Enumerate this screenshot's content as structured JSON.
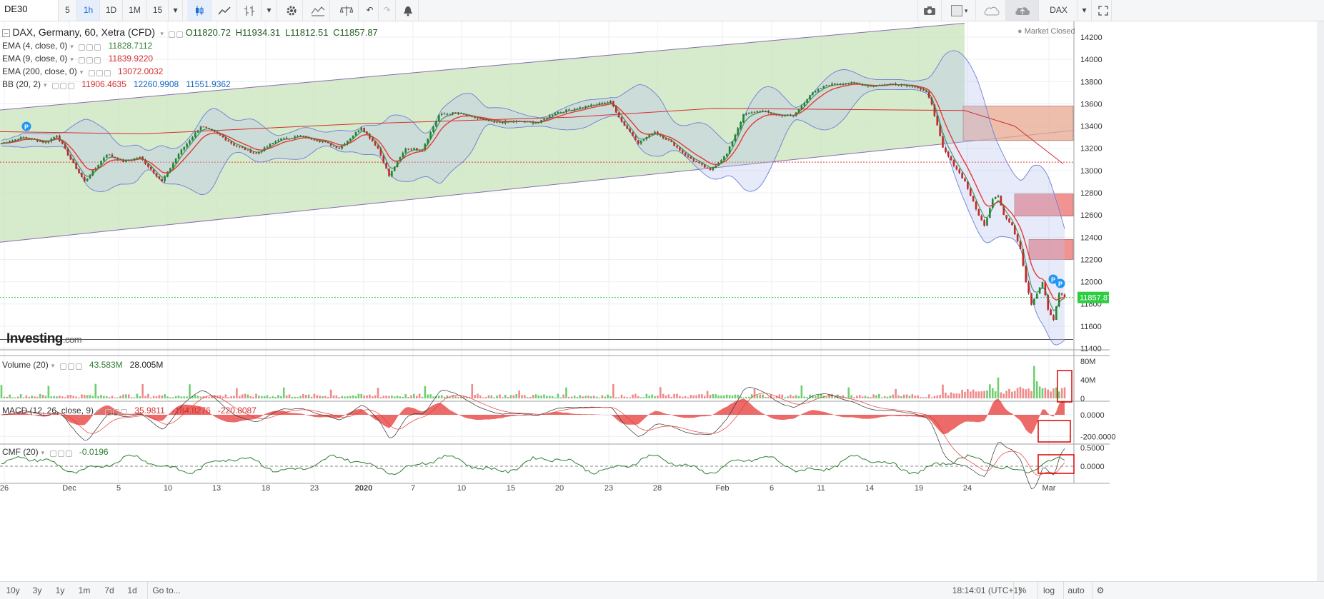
{
  "toolbar": {
    "symbol": "DE30",
    "intervals": [
      "5",
      "1h",
      "1D",
      "1M",
      "15"
    ],
    "active_interval": "1h",
    "right_symbol": "DAX"
  },
  "legend": {
    "main": {
      "title": "DAX, Germany, 60, Xetra (CFD)",
      "open": "O11820.72",
      "high": "H11934.31",
      "low": "L11812.51",
      "close": "C11857.87"
    },
    "ema4": {
      "label": "EMA (4, close, 0)",
      "value": "11828.7112"
    },
    "ema9": {
      "label": "EMA (9, close, 0)",
      "value": "11839.9220"
    },
    "ema200": {
      "label": "EMA (200, close, 0)",
      "value": "13072.0032"
    },
    "bb": {
      "label": "BB (20, 2)",
      "v1": "11906.4635",
      "v2": "12260.9908",
      "v3": "11551.9362"
    },
    "market_status": "Market Closed",
    "logo_main": "Investing",
    "logo_suffix": ".com",
    "last_price": "11857.87"
  },
  "volume_legend": {
    "label": "Volume (20)",
    "v1": "43.583M",
    "v2": "28.005M"
  },
  "macd_legend": {
    "label": "MACD (12, 26, close, 9)",
    "v1": "35.9811",
    "v2": "-184.8276",
    "v3": "-220.8087"
  },
  "cmf_legend": {
    "label": "CMF (20)",
    "v1": "-0.0196"
  },
  "bottom": {
    "ranges": [
      "10y",
      "3y",
      "1y",
      "1m",
      "7d",
      "1d"
    ],
    "goto": "Go to...",
    "time": "18:14:01 (UTC+1)",
    "pct": "%",
    "log": "log",
    "auto": "auto"
  },
  "colors": {
    "up": "#26a69a",
    "down": "#ef5350",
    "channel": "#cfe6c3",
    "bb": "#6b7fd7",
    "ema200": "#d32f2f",
    "zone_orange": "#e5a88f",
    "zone_red": "#f08080"
  },
  "chart_data": [
    {
      "type": "candlestick",
      "title": "DAX, Germany, 60, Xetra (CFD)",
      "x_labels": [
        "26",
        "Dec",
        "5",
        "10",
        "13",
        "18",
        "23",
        "2020",
        "7",
        "10",
        "15",
        "20",
        "23",
        "28",
        "Feb",
        "6",
        "11",
        "14",
        "19",
        "24",
        "Mar"
      ],
      "y_ticks": [
        11400,
        11600,
        11800,
        12000,
        12200,
        12400,
        12600,
        12800,
        13000,
        13200,
        13400,
        13600,
        13800,
        14000,
        14200
      ],
      "ylim": [
        11350,
        14300
      ],
      "path": [
        [
          0,
          13245
        ],
        [
          8,
          13300
        ],
        [
          16,
          13250
        ],
        [
          20,
          13320
        ],
        [
          25,
          13100
        ],
        [
          30,
          12900
        ],
        [
          38,
          13150
        ],
        [
          44,
          13080
        ],
        [
          50,
          13120
        ],
        [
          58,
          12900
        ],
        [
          64,
          13150
        ],
        [
          72,
          13400
        ],
        [
          78,
          13330
        ],
        [
          84,
          13230
        ],
        [
          92,
          13150
        ],
        [
          100,
          13280
        ],
        [
          108,
          13310
        ],
        [
          116,
          13260
        ],
        [
          122,
          13200
        ],
        [
          130,
          13390
        ],
        [
          136,
          13200
        ],
        [
          140,
          12950
        ],
        [
          146,
          13200
        ],
        [
          152,
          13190
        ],
        [
          158,
          13500
        ],
        [
          164,
          13520
        ],
        [
          170,
          13480
        ],
        [
          178,
          13430
        ],
        [
          186,
          13440
        ],
        [
          194,
          13430
        ],
        [
          200,
          13520
        ],
        [
          206,
          13550
        ],
        [
          214,
          13590
        ],
        [
          220,
          13620
        ],
        [
          224,
          13440
        ],
        [
          230,
          13250
        ],
        [
          236,
          13350
        ],
        [
          242,
          13250
        ],
        [
          248,
          13120
        ],
        [
          256,
          13000
        ],
        [
          262,
          13150
        ],
        [
          268,
          13500
        ],
        [
          274,
          13540
        ],
        [
          280,
          13500
        ],
        [
          286,
          13490
        ],
        [
          292,
          13680
        ],
        [
          298,
          13770
        ],
        [
          306,
          13790
        ],
        [
          314,
          13760
        ],
        [
          322,
          13780
        ],
        [
          330,
          13760
        ],
        [
          334,
          13700
        ],
        [
          336,
          13600
        ],
        [
          340,
          13200
        ],
        [
          344,
          13050
        ],
        [
          348,
          12900
        ],
        [
          352,
          12650
        ],
        [
          355,
          12500
        ],
        [
          358,
          12750
        ],
        [
          360,
          12780
        ],
        [
          362,
          12600
        ],
        [
          365,
          12500
        ],
        [
          368,
          12300
        ],
        [
          370,
          12000
        ],
        [
          372,
          11800
        ],
        [
          374,
          11900
        ],
        [
          376,
          12000
        ],
        [
          378,
          11750
        ],
        [
          380,
          11650
        ],
        [
          382,
          11900
        ],
        [
          384,
          11860
        ]
      ],
      "ema200_values": [
        13350,
        13330,
        13420,
        13480,
        13560,
        13540,
        13400,
        13060
      ],
      "channel": {
        "upper": [
          13545,
          14325
        ],
        "lower": [
          12355,
          13260
        ]
      },
      "zones": [
        {
          "color": "orange",
          "from": 13270,
          "to": 13580
        },
        {
          "color": "red",
          "from": 12590,
          "to": 12790
        },
        {
          "color": "red",
          "from": 12200,
          "to": 12380
        }
      ],
      "markers": [
        "P",
        "P",
        "P"
      ]
    },
    {
      "type": "bar",
      "title": "Volume (20)",
      "y_ticks": [
        "80M",
        "40M",
        "0"
      ],
      "ylim": [
        0,
        80
      ]
    },
    {
      "type": "line",
      "title": "MACD (12, 26, close, 9)",
      "y_ticks": [
        "0.0000",
        "-200.0000"
      ],
      "ylim": [
        -290,
        50
      ]
    },
    {
      "type": "line",
      "title": "CMF (20)",
      "y_ticks": [
        "0.5000",
        "0.0000"
      ],
      "ylim": [
        -0.3,
        0.6
      ]
    }
  ]
}
